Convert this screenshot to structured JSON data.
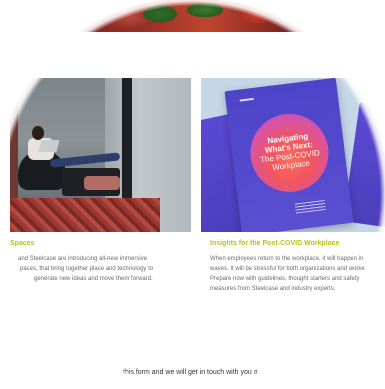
{
  "left_card": {
    "title": "Spaces",
    "body_lines": [
      "and Steelcase are introducing all-new immersive",
      "paces, that bring together place and technology to",
      "generate new ideas and move them forward."
    ]
  },
  "right_card": {
    "title": "Insights for the Post-COVID Workplace",
    "body_lines": [
      "When employees return to the workplace, it will happen in",
      "waves. It will be stressful for both organizations and worke",
      "Prepare now with guidelines, thought starters and safety",
      "measures from Steelcase and industry experts."
    ],
    "cover": {
      "line1": "Navigating",
      "line2": "What's Next:",
      "line3": "The Post-COVID",
      "line4": "Workplace"
    }
  },
  "footer": {
    "text": "this form and we will get in touch with you a"
  },
  "colors": {
    "accent": "#b7c21b",
    "body_text": "#6b6b6b",
    "cover_purple": "#4e44c9",
    "orb": "#f2565e"
  }
}
